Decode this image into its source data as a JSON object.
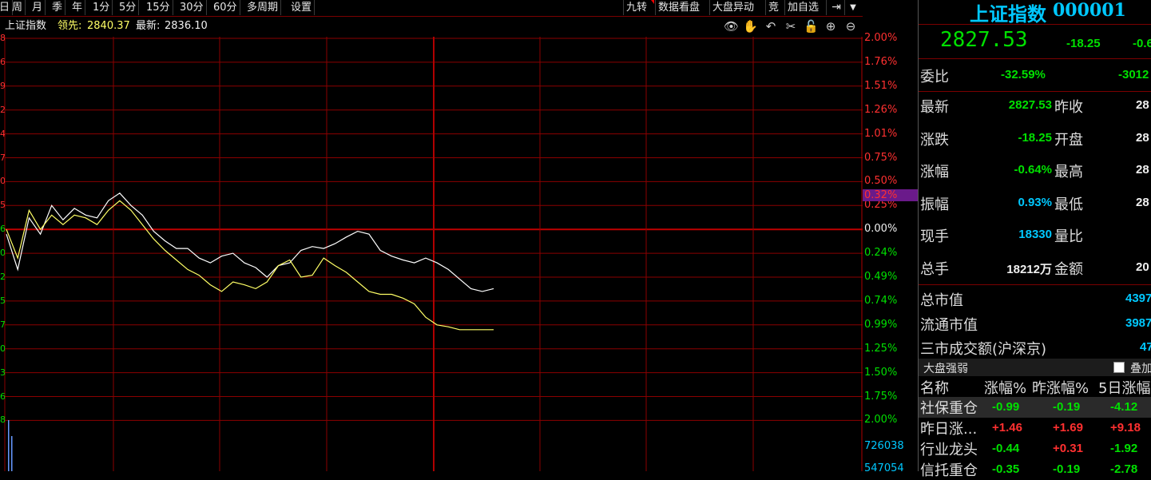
{
  "toolbar": {
    "left_items": [
      "日",
      "周",
      "月",
      "季",
      "年",
      "1分",
      "5分",
      "15分",
      "30分",
      "60分",
      "多周期",
      "设置"
    ],
    "right_items": [
      "九转",
      "数据看盘",
      "大盘异动",
      "竞",
      "加自选"
    ],
    "pin_icon": "pin-icon",
    "dropdown_icon": "caret-down-icon"
  },
  "infobar": {
    "index_name": "上证指数",
    "lead_label": "领先:",
    "lead_value": "2840.37",
    "latest_label": "最新:",
    "latest_value": "2836.10",
    "tools": [
      "eye-icon",
      "hand-icon",
      "undo-icon",
      "scissors-icon",
      "lock-icon",
      "zoom-in-icon",
      "zoom-out-icon"
    ]
  },
  "axis": {
    "right_labels": [
      "2.00%",
      "1.76%",
      "1.51%",
      "1.26%",
      "1.01%",
      "0.75%",
      "0.50%",
      "0.25%",
      "0.00%",
      "0.24%",
      "0.49%",
      "0.74%",
      "0.99%",
      "1.25%",
      "1.50%",
      "1.75%",
      "2.00%"
    ],
    "highlight_label": "0.32%",
    "volume_labels": [
      "726038",
      "547054"
    ],
    "left_stubs": [
      "8",
      "6",
      "9",
      "2",
      "4",
      "7",
      "0",
      "5",
      "6",
      "0",
      "2",
      "5",
      "7",
      "0",
      "3",
      "6",
      "8"
    ]
  },
  "colors": {
    "grid": "#8b0000",
    "zero_line": "#c00000",
    "price_line": "#ffffff",
    "avg_line": "#ffff66",
    "up": "#ff3030",
    "down": "#00e000",
    "highlight_bg": "#6a1a8a"
  },
  "chart_data": {
    "type": "line",
    "series": [
      {
        "name": "最新",
        "values": [
          -0.05,
          -0.42,
          0.12,
          -0.05,
          0.25,
          0.1,
          0.22,
          0.15,
          0.12,
          0.3,
          0.38,
          0.25,
          0.15,
          -0.02,
          -0.12,
          -0.2,
          -0.2,
          -0.3,
          -0.35,
          -0.28,
          -0.25,
          -0.35,
          -0.4,
          -0.5,
          -0.38,
          -0.35,
          -0.22,
          -0.18,
          -0.2,
          -0.15,
          -0.08,
          -0.02,
          -0.05,
          -0.22,
          -0.28,
          -0.32,
          -0.35,
          -0.3,
          -0.35,
          -0.42,
          -0.52,
          -0.62,
          -0.65,
          -0.62
        ]
      },
      {
        "name": "领先",
        "values": [
          0.0,
          -0.3,
          0.2,
          0.0,
          0.15,
          0.05,
          0.15,
          0.12,
          0.05,
          0.2,
          0.3,
          0.2,
          0.05,
          -0.1,
          -0.22,
          -0.32,
          -0.42,
          -0.48,
          -0.58,
          -0.65,
          -0.55,
          -0.58,
          -0.62,
          -0.55,
          -0.38,
          -0.32,
          -0.5,
          -0.48,
          -0.3,
          -0.38,
          -0.45,
          -0.55,
          -0.65,
          -0.68,
          -0.68,
          -0.72,
          -0.78,
          -0.92,
          -1.0,
          -1.02,
          -1.05,
          -1.05,
          -1.05,
          -1.05
        ]
      }
    ],
    "ylim": [
      -2.0,
      2.0
    ],
    "grid": true
  },
  "panel": {
    "title": "上证指数",
    "code": "000001",
    "price": "2827.53",
    "change": "-18.25",
    "change_pct_partial": "-0.6",
    "webi_label": "委比",
    "webi_value": "-32.59%",
    "webi_diff": "-3012",
    "rows": [
      {
        "l1": "最新",
        "v1": "2827.53",
        "c1": "green",
        "l2": "昨收",
        "v2": "28"
      },
      {
        "l1": "涨跌",
        "v1": "-18.25",
        "c1": "green",
        "l2": "开盘",
        "v2": "28"
      },
      {
        "l1": "涨幅",
        "v1": "-0.64%",
        "c1": "green",
        "l2": "最高",
        "v2": "28"
      },
      {
        "l1": "振幅",
        "v1": "0.93%",
        "c1": "cyan",
        "l2": "最低",
        "v2": "28"
      },
      {
        "l1": "现手",
        "v1": "18330",
        "c1": "cyan",
        "l2": "量比",
        "v2": ""
      },
      {
        "l1": "总手",
        "v1": "18212万",
        "c1": "white",
        "l2": "金额",
        "v2": "20"
      }
    ],
    "market_cap_label": "总市值",
    "market_cap_value": "4397",
    "float_cap_label": "流通市值",
    "float_cap_value": "3987",
    "turnover_label": "三市成交额(沪深京)",
    "turnover_value": "47",
    "sector_header": "大盘强弱",
    "overlay_label": "叠加",
    "col_headers": [
      "名称",
      "涨幅%",
      "昨涨幅%",
      "5日涨幅"
    ],
    "sectors": [
      {
        "name": "社保重仓",
        "a": "-0.99",
        "b": "-0.19",
        "c": "-4.12",
        "ca": "green",
        "cb": "green",
        "cc": "green"
      },
      {
        "name": "昨日涨...",
        "a": "+1.46",
        "b": "+1.69",
        "c": "+9.18",
        "ca": "red",
        "cb": "red",
        "cc": "red"
      },
      {
        "name": "行业龙头",
        "a": "-0.44",
        "b": "+0.31",
        "c": "-1.92",
        "ca": "green",
        "cb": "red",
        "cc": "green"
      },
      {
        "name": "信托重仓",
        "a": "-0.35",
        "b": "-0.19",
        "c": "-2.78",
        "ca": "green",
        "cb": "green",
        "cc": "green"
      }
    ]
  }
}
